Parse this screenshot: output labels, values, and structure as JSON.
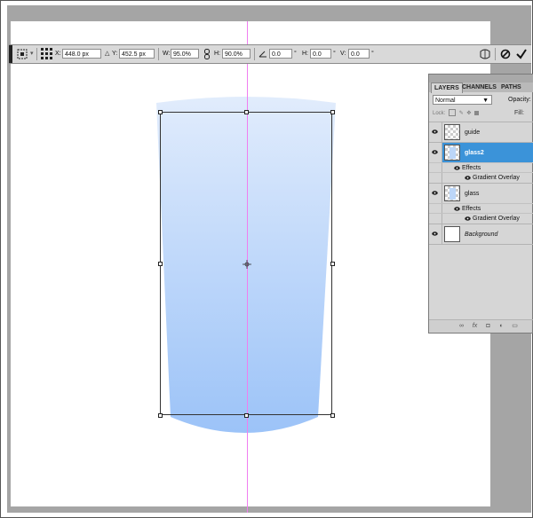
{
  "options_bar": {
    "x_label": "X:",
    "x_value": "448.0 px",
    "delta_icon": "triangle-delta-icon",
    "y_label": "Y:",
    "y_value": "452.5 px",
    "w_label": "W:",
    "w_value": "95.0%",
    "link_icon": "chain-link-icon",
    "h_label": "H:",
    "h_value": "90.0%",
    "angle_value": "0.0",
    "degree": "°",
    "hskew_label": "H:",
    "hskew_value": "0.0",
    "vskew_label": "V:",
    "vskew_value": "0.0",
    "warp_icon": "warp-mode-icon",
    "cancel_icon": "cancel-transform-icon",
    "commit_icon": "commit-transform-icon"
  },
  "layers_panel": {
    "tabs": [
      "LAYERS",
      "CHANNELS",
      "PATHS"
    ],
    "active_tab": "LAYERS",
    "blend_mode": "Normal",
    "opacity_label": "Opacity:",
    "lock_label": "Lock:",
    "fill_label": "Fill:",
    "layers": [
      {
        "name": "guide",
        "selected": false,
        "thumb": "transparent"
      },
      {
        "name": "glass2",
        "selected": true,
        "thumb": "glass"
      },
      {
        "name": "glass",
        "selected": false,
        "thumb": "glass"
      },
      {
        "name": "Background",
        "selected": false,
        "thumb": "white"
      }
    ],
    "effects_label": "Effects",
    "gradient_overlay_label": "Gradient Overlay"
  },
  "colors": {
    "selected_layer": "#3b93d9",
    "guide": "#f07ef0",
    "glass_top": "#d7e7fb",
    "glass_bottom": "#9fc5f8",
    "pasteboard": "#a5a5a5"
  }
}
